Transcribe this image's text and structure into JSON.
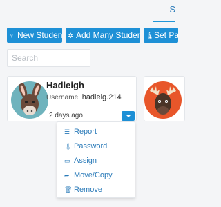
{
  "header": {
    "partial_tab_text": "S"
  },
  "toolbar": {
    "new_student_label": "New Student",
    "add_many_label": "Add Many Students",
    "set_password_label": "Set Pa"
  },
  "search": {
    "placeholder": "Search"
  },
  "student_card": {
    "name": "Hadleigh",
    "username_label": "Username:",
    "username": "hadleig.214",
    "time": "2 days ago"
  },
  "dropdown_menu": {
    "items": [
      {
        "label": "Report",
        "icon": "list-icon"
      },
      {
        "label": "Password",
        "icon": "thermometer-key-icon"
      },
      {
        "label": "Assign",
        "icon": "calendar-icon"
      },
      {
        "label": "Move/Copy",
        "icon": "share-arrow-icon"
      },
      {
        "label": "Remove",
        "icon": "trash-icon"
      }
    ]
  },
  "colors": {
    "accent": "#1e90d6",
    "link": "#2b7bb9",
    "avatar1_bg": "#6fb3bd",
    "avatar2_bg": "#e8562a"
  }
}
